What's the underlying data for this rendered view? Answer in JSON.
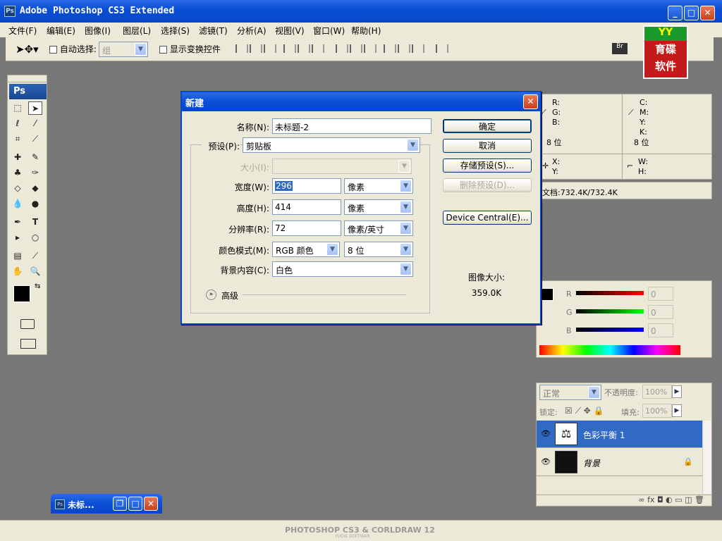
{
  "window": {
    "title": "Adobe Photoshop CS3 Extended",
    "app_icon": "Ps"
  },
  "menu": [
    "文件(F)",
    "编辑(E)",
    "图像(I)",
    "图层(L)",
    "选择(S)",
    "滤镜(T)",
    "分析(A)",
    "视图(V)",
    "窗口(W)",
    "帮助(H)"
  ],
  "options": {
    "auto_select_label": "自动选择:",
    "auto_select_value": "组",
    "show_transform_label": "显示变换控件"
  },
  "logo": {
    "line1": "育碟",
    "line2": "软件",
    "top": "YY"
  },
  "toolbox": {
    "header": "Ps"
  },
  "dialog": {
    "title": "新建",
    "name_label": "名称(N):",
    "name_value": "未标题-2",
    "preset_label": "预设(P):",
    "preset_value": "剪贴板",
    "size_label": "大小(I):",
    "width_label": "宽度(W):",
    "width_value": "296",
    "width_unit": "像素",
    "height_label": "高度(H):",
    "height_value": "414",
    "height_unit": "像素",
    "resolution_label": "分辨率(R):",
    "resolution_value": "72",
    "resolution_unit": "像素/英寸",
    "color_mode_label": "颜色模式(M):",
    "color_mode_value": "RGB 颜色",
    "bit_depth": "8 位",
    "background_label": "背景内容(C):",
    "background_value": "白色",
    "advanced_label": "高级",
    "ok": "确定",
    "cancel": "取消",
    "save_preset": "存储预设(S)...",
    "delete_preset": "删除预设(D)...",
    "device_central": "Device Central(E)...",
    "image_size_label": "图像大小:",
    "image_size_value": "359.0K"
  },
  "info": {
    "r": "R:",
    "g": "G:",
    "b": "B:",
    "c": "C:",
    "m": "M:",
    "y": "Y:",
    "k": "K:",
    "bits_left": "8 位",
    "bits_right": "8 位",
    "x": "X:",
    "yy": "Y:",
    "w": "W:",
    "h": "H:",
    "doc": "文档:732.4K/732.4K"
  },
  "color": {
    "r": "R",
    "g": "G",
    "b": "B",
    "r_val": "0",
    "g_val": "0",
    "b_val": "0"
  },
  "layers": {
    "blend_mode": "正常",
    "opacity_label": "不透明度:",
    "opacity_value": "100%",
    "lock_label": "锁定:",
    "fill_label": "填充:",
    "fill_value": "100%",
    "items": [
      {
        "name": "色彩平衡 1"
      },
      {
        "name": "背景"
      }
    ]
  },
  "doc_tab": {
    "title": "未标..."
  },
  "footer": {
    "text": "PHOTOSHOP CS3 & CORLDRAW 12",
    "sub": "YUDIE SOFTWAR"
  }
}
